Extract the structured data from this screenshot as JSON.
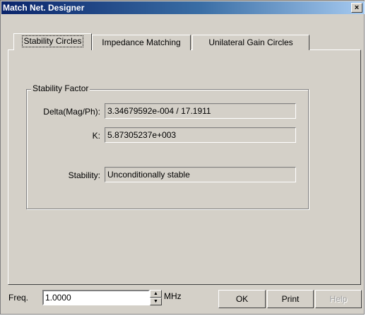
{
  "window": {
    "title": "Match Net. Designer",
    "close_label": "×"
  },
  "tabs": [
    {
      "label": "Stability Circles"
    },
    {
      "label": "Impedance Matching"
    },
    {
      "label": "Unilateral Gain Circles"
    }
  ],
  "group": {
    "title": "Stability Factor",
    "fields": [
      {
        "label": "Delta(Mag/Ph):",
        "value": "3.34679592e-004 / 17.1911"
      },
      {
        "label": "K:",
        "value": "5.87305237e+003"
      },
      {
        "label": "Stability:",
        "value": "Unconditionally stable"
      }
    ]
  },
  "frequency": {
    "label": "Freq.",
    "value": "1.0000",
    "units": "MHz"
  },
  "buttons": {
    "ok": "OK",
    "print": "Print",
    "help": "Help"
  }
}
